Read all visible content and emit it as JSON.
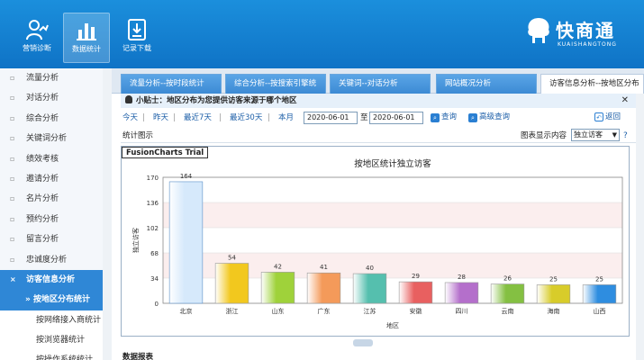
{
  "header": {
    "nav": [
      {
        "label": "营销诊断",
        "icon": "person-chart-icon"
      },
      {
        "label": "数据统计",
        "icon": "bar-chart-icon",
        "active": true
      },
      {
        "label": "记录下载",
        "icon": "download-icon"
      }
    ],
    "logo_text": "快商通",
    "logo_sub": "KUAISHANGTONG"
  },
  "sidebar": {
    "items": [
      {
        "label": "流量分析"
      },
      {
        "label": "对话分析"
      },
      {
        "label": "综合分析"
      },
      {
        "label": "关键词分析"
      },
      {
        "label": "绩效考核"
      },
      {
        "label": "邀请分析"
      },
      {
        "label": "名片分析"
      },
      {
        "label": "预约分析"
      },
      {
        "label": "留言分析"
      },
      {
        "label": "忠诚度分析"
      },
      {
        "label": "访客信息分析",
        "active": true
      },
      {
        "label": "按地区分布统计",
        "sub": true,
        "selected": true
      },
      {
        "label": "按网络接入商统计",
        "sub2": true
      },
      {
        "label": "按浏览器统计",
        "sub2": true
      },
      {
        "label": "按操作系统统计",
        "sub2": true
      }
    ]
  },
  "tabs": [
    {
      "label": "流量分析--按时段统计"
    },
    {
      "label": "综合分析--按搜索引擎统"
    },
    {
      "label": "关键词--对话分析"
    },
    {
      "label": "网站概况分析"
    },
    {
      "label": "访客信息分析--按地区分布",
      "active": true
    }
  ],
  "tip": {
    "prefix": "小贴士：",
    "text": "地区分布为您提供访客来源于哪个地区"
  },
  "filters": {
    "today": "今天",
    "yesterday": "昨天",
    "last7": "最近7天",
    "last30": "最近30天",
    "month": "本月",
    "start_date": "2020-06-01",
    "to": "至",
    "end_date": "2020-06-01",
    "query": "查询",
    "advanced": "高级查询",
    "return": "返回"
  },
  "section": {
    "title": "统计图示",
    "mode_label": "图表显示内容",
    "mode_value": "独立访客",
    "help": "?"
  },
  "chart_badge": "FusionCharts Trial",
  "chart_data": {
    "type": "bar",
    "title": "按地区统计独立访客",
    "xlabel": "地区",
    "ylabel": "独立访客",
    "categories": [
      "北京",
      "浙江",
      "山东",
      "广东",
      "江苏",
      "安徽",
      "四川",
      "云南",
      "海南",
      "山西"
    ],
    "values": [
      164,
      54,
      42,
      41,
      40,
      29,
      28,
      26,
      25,
      25
    ],
    "ylim": [
      0,
      170
    ],
    "yticks": [
      0,
      34,
      68,
      102,
      136,
      170
    ],
    "colors": [
      "#d6e9fb",
      "#f2c81e",
      "#9fd23a",
      "#f49a5a",
      "#55bfae",
      "#e86060",
      "#b46fcb",
      "#84c042",
      "#d8cc2a",
      "#2e8de0"
    ],
    "grid": true
  },
  "bottom_title": "数据报表"
}
